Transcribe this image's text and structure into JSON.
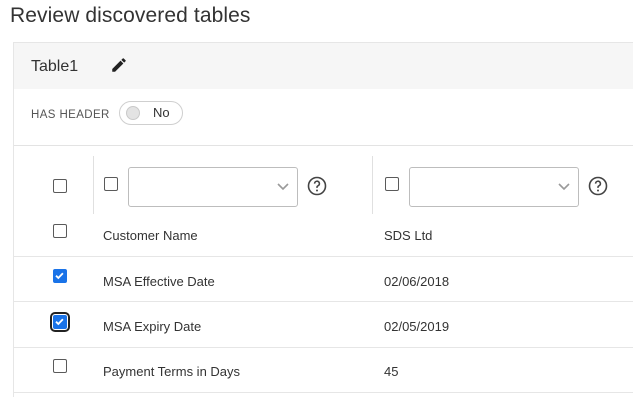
{
  "page": {
    "title": "Review discovered tables"
  },
  "table": {
    "name": "Table1",
    "has_header_label": "HAS HEADER",
    "has_header_value": "No",
    "columns": [
      {
        "select_value": "",
        "checked": false
      },
      {
        "select_value": "",
        "checked": false
      }
    ],
    "rows": [
      {
        "checked": false,
        "field": "Customer Name",
        "value": "SDS Ltd"
      },
      {
        "checked": true,
        "field": "MSA Effective Date",
        "value": "02/06/2018"
      },
      {
        "checked": true,
        "field": "MSA Expiry Date",
        "value": "02/05/2019"
      },
      {
        "checked": false,
        "field": "Payment Terms in Days",
        "value": "45"
      }
    ]
  },
  "colors": {
    "accent": "#1a73e8",
    "header_bg": "#f6f6f6",
    "border": "#e6e6e6"
  }
}
